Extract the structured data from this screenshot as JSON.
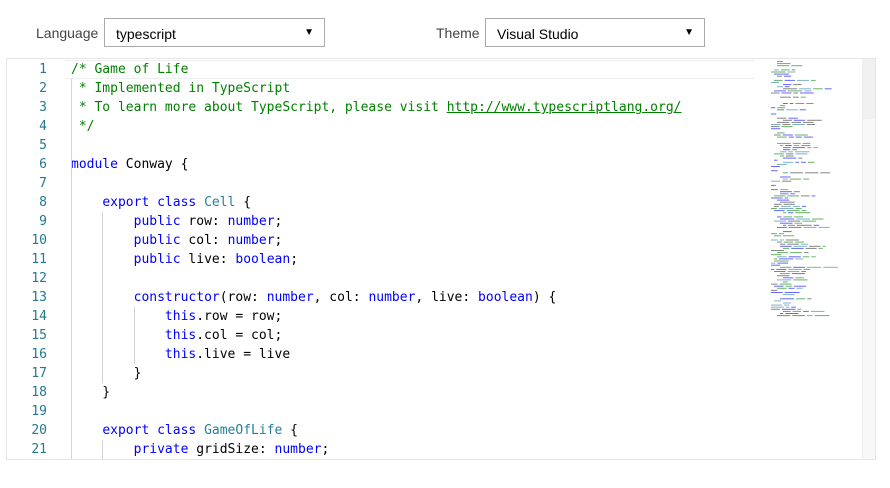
{
  "toolbar": {
    "language_label": "Language",
    "language_value": "typescript",
    "theme_label": "Theme",
    "theme_value": "Visual Studio"
  },
  "editor": {
    "current_line": 1,
    "lines": [
      [
        [
          "/* Game of Life",
          "c"
        ]
      ],
      [
        [
          " * Implemented in TypeScript",
          "c"
        ]
      ],
      [
        [
          " * To learn more about TypeScript, please visit ",
          "c"
        ],
        [
          "http://www.typescriptlang.org/",
          "u"
        ]
      ],
      [
        [
          " */",
          "c"
        ]
      ],
      [],
      [
        [
          "module",
          "k"
        ],
        [
          " Conway {",
          "p"
        ]
      ],
      [],
      [
        [
          "    ",
          "p"
        ],
        [
          "export",
          "k"
        ],
        [
          " ",
          "p"
        ],
        [
          "class",
          "k"
        ],
        [
          " ",
          "p"
        ],
        [
          "Cell",
          "t"
        ],
        [
          " {",
          "p"
        ]
      ],
      [
        [
          "        ",
          "p"
        ],
        [
          "public",
          "k"
        ],
        [
          " row: ",
          "p"
        ],
        [
          "number",
          "n"
        ],
        [
          ";",
          "p"
        ]
      ],
      [
        [
          "        ",
          "p"
        ],
        [
          "public",
          "k"
        ],
        [
          " col: ",
          "p"
        ],
        [
          "number",
          "n"
        ],
        [
          ";",
          "p"
        ]
      ],
      [
        [
          "        ",
          "p"
        ],
        [
          "public",
          "k"
        ],
        [
          " live: ",
          "p"
        ],
        [
          "boolean",
          "n"
        ],
        [
          ";",
          "p"
        ]
      ],
      [],
      [
        [
          "        ",
          "p"
        ],
        [
          "constructor",
          "k"
        ],
        [
          "(row: ",
          "p"
        ],
        [
          "number",
          "n"
        ],
        [
          ", col: ",
          "p"
        ],
        [
          "number",
          "n"
        ],
        [
          ", live: ",
          "p"
        ],
        [
          "boolean",
          "n"
        ],
        [
          ") {",
          "p"
        ]
      ],
      [
        [
          "            ",
          "p"
        ],
        [
          "this",
          "k"
        ],
        [
          ".row = row;",
          "p"
        ]
      ],
      [
        [
          "            ",
          "p"
        ],
        [
          "this",
          "k"
        ],
        [
          ".col = col;",
          "p"
        ]
      ],
      [
        [
          "            ",
          "p"
        ],
        [
          "this",
          "k"
        ],
        [
          ".live = live",
          "p"
        ]
      ],
      [
        [
          "        }",
          "p"
        ]
      ],
      [
        [
          "    }",
          "p"
        ]
      ],
      [],
      [
        [
          "    ",
          "p"
        ],
        [
          "export",
          "k"
        ],
        [
          " ",
          "p"
        ],
        [
          "class",
          "k"
        ],
        [
          " ",
          "p"
        ],
        [
          "GameOfLife",
          "t"
        ],
        [
          " {",
          "p"
        ]
      ],
      [
        [
          "        ",
          "p"
        ],
        [
          "private",
          "k"
        ],
        [
          " gridSize: ",
          "p"
        ],
        [
          "number",
          "n"
        ],
        [
          ";",
          "p"
        ]
      ]
    ]
  }
}
